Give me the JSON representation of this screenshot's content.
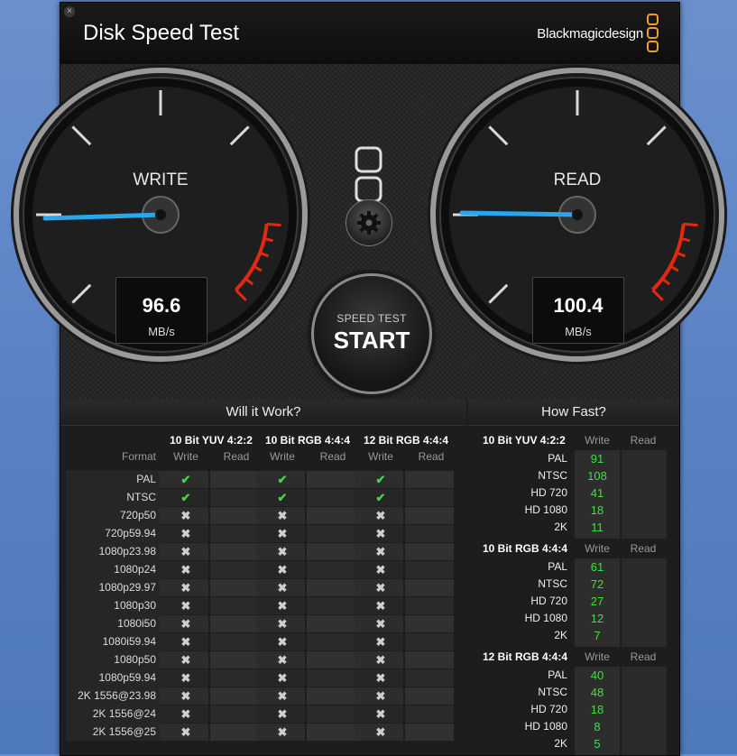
{
  "window": {
    "title": "Disk Speed Test",
    "brand": "Blackmagicdesign",
    "close_glyph": "×"
  },
  "gauges": {
    "write": {
      "label": "WRITE",
      "value": "96.6",
      "unit": "MB/s",
      "needle_fraction": 0.16
    },
    "read": {
      "label": "READ",
      "value": "100.4",
      "unit": "MB/s",
      "needle_fraction": 0.17
    }
  },
  "start_button": {
    "sub_label": "SPEED TEST",
    "main_label": "START"
  },
  "settings_icon": "gear-icon",
  "colors": {
    "accent_needle": "#2aa6ee",
    "redline": "#e02a10",
    "value_green": "#3ee03e",
    "check_green": "#48d648"
  },
  "will_it_work": {
    "header": "Will it Work?",
    "format_label": "Format",
    "write_label": "Write",
    "read_label": "Read",
    "groups": [
      "10 Bit YUV 4:2:2",
      "10 Bit RGB 4:4:4",
      "12 Bit RGB 4:4:4"
    ],
    "rows": [
      {
        "format": "PAL",
        "write": [
          "check",
          "check",
          "check"
        ]
      },
      {
        "format": "NTSC",
        "write": [
          "check",
          "check",
          "check"
        ]
      },
      {
        "format": "720p50",
        "write": [
          "cross",
          "cross",
          "cross"
        ]
      },
      {
        "format": "720p59.94",
        "write": [
          "cross",
          "cross",
          "cross"
        ]
      },
      {
        "format": "1080p23.98",
        "write": [
          "cross",
          "cross",
          "cross"
        ]
      },
      {
        "format": "1080p24",
        "write": [
          "cross",
          "cross",
          "cross"
        ]
      },
      {
        "format": "1080p29.97",
        "write": [
          "cross",
          "cross",
          "cross"
        ]
      },
      {
        "format": "1080p30",
        "write": [
          "cross",
          "cross",
          "cross"
        ]
      },
      {
        "format": "1080i50",
        "write": [
          "cross",
          "cross",
          "cross"
        ]
      },
      {
        "format": "1080i59.94",
        "write": [
          "cross",
          "cross",
          "cross"
        ]
      },
      {
        "format": "1080p50",
        "write": [
          "cross",
          "cross",
          "cross"
        ]
      },
      {
        "format": "1080p59.94",
        "write": [
          "cross",
          "cross",
          "cross"
        ]
      },
      {
        "format": "2K 1556@23.98",
        "write": [
          "cross",
          "cross",
          "cross"
        ]
      },
      {
        "format": "2K 1556@24",
        "write": [
          "cross",
          "cross",
          "cross"
        ]
      },
      {
        "format": "2K 1556@25",
        "write": [
          "cross",
          "cross",
          "cross"
        ]
      }
    ]
  },
  "how_fast": {
    "header": "How Fast?",
    "write_label": "Write",
    "read_label": "Read",
    "sections": [
      {
        "title": "10 Bit YUV 4:2:2",
        "rows": [
          {
            "format": "PAL",
            "write": "91"
          },
          {
            "format": "NTSC",
            "write": "108"
          },
          {
            "format": "HD 720",
            "write": "41"
          },
          {
            "format": "HD 1080",
            "write": "18"
          },
          {
            "format": "2K",
            "write": "11"
          }
        ]
      },
      {
        "title": "10 Bit RGB 4:4:4",
        "rows": [
          {
            "format": "PAL",
            "write": "61"
          },
          {
            "format": "NTSC",
            "write": "72"
          },
          {
            "format": "HD 720",
            "write": "27"
          },
          {
            "format": "HD 1080",
            "write": "12"
          },
          {
            "format": "2K",
            "write": "7"
          }
        ]
      },
      {
        "title": "12 Bit RGB 4:4:4",
        "rows": [
          {
            "format": "PAL",
            "write": "40"
          },
          {
            "format": "NTSC",
            "write": "48"
          },
          {
            "format": "HD 720",
            "write": "18"
          },
          {
            "format": "HD 1080",
            "write": "8"
          },
          {
            "format": "2K",
            "write": "5"
          }
        ]
      }
    ]
  }
}
